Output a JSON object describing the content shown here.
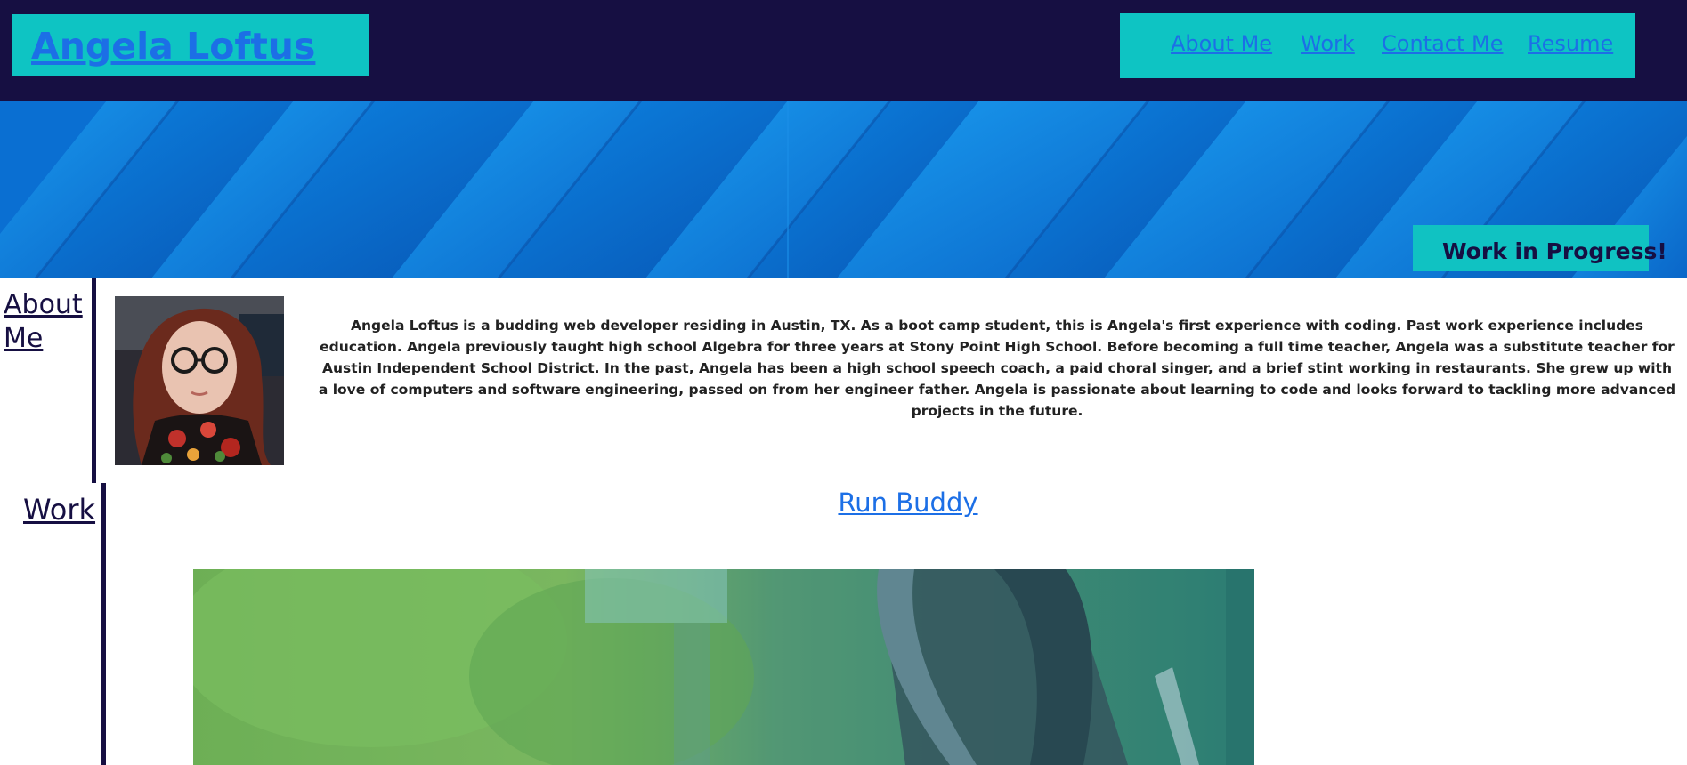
{
  "header": {
    "title": "Angela Loftus",
    "nav": [
      {
        "label": "About Me"
      },
      {
        "label": "Work"
      },
      {
        "label": "Contact Me"
      },
      {
        "label": "Resume"
      }
    ]
  },
  "hero": {
    "badge": "Work in Progress!"
  },
  "about": {
    "heading": "About Me",
    "bio": "Angela Loftus is a budding web developer residing in Austin, TX. As a boot camp student, this is Angela's first experience with coding. Past work experience includes education. Angela previously taught high school Algebra for three years at Stony Point High School. Before becoming a full time teacher, Angela was a substitute teacher for Austin Independent School District. In the past, Angela has been a high school speech coach, a paid choral singer, and a brief stint working in restaurants. She grew up with a love of computers and software engineering, passed on from her engineer father. Angela is passionate about learning to code and looks forward to tackling more advanced projects in the future."
  },
  "work": {
    "heading": "Work",
    "projects": [
      {
        "title": "Run Buddy"
      }
    ]
  },
  "colors": {
    "header_bg": "#160f42",
    "accent_teal": "#0ec4c3",
    "link_blue": "#1c6fe6",
    "hero_blue": "#0a6fd2"
  }
}
